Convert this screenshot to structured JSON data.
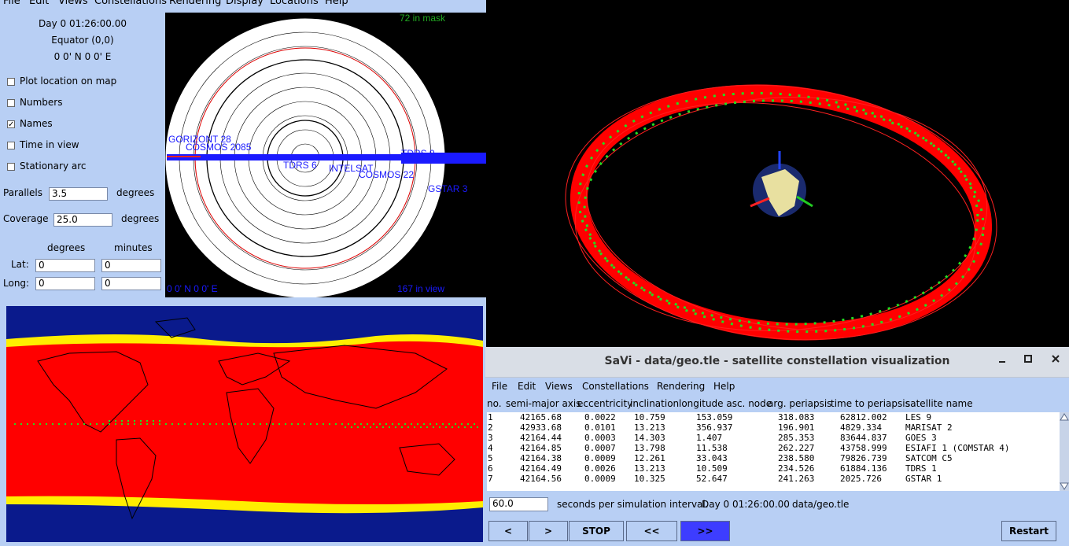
{
  "coverage_window": {
    "menu": [
      "File",
      "Edit",
      "Views",
      "Constellations",
      "Rendering",
      "Display",
      "Locations",
      "Help"
    ],
    "time_text": "Day 0  01:26:00.00",
    "location_name": "Equator (0,0)",
    "location_coords": "0  0' N 0  0' E",
    "checkboxes": [
      {
        "label": "Plot location on map",
        "checked": false,
        "mark": ""
      },
      {
        "label": "Numbers",
        "checked": false,
        "mark": ""
      },
      {
        "label": "Names",
        "checked": true,
        "mark": "✓"
      },
      {
        "label": "Time in view",
        "checked": false,
        "mark": ""
      },
      {
        "label": "Stationary arc",
        "checked": false,
        "mark": ""
      }
    ],
    "parallels": {
      "label": "Parallels",
      "value": "3.5",
      "unit": "degrees"
    },
    "coverage": {
      "label": "Coverage",
      "value": "25.0",
      "unit": "degrees"
    },
    "col_degrees": "degrees",
    "col_minutes": "minutes",
    "lat": {
      "label": "Lat:",
      "deg": "0",
      "min": "0"
    },
    "long": {
      "label": "Long:",
      "deg": "0",
      "min": "0"
    }
  },
  "polar_view": {
    "mask_count": "72 in mask",
    "view_count": "167 in view",
    "corner_coords": "0  0' N 0  0' E",
    "sat_labels": [
      {
        "text": "GORIZONT 28",
        "color": "#1a1aff"
      },
      {
        "text": "COSMOS 2085",
        "color": "#1a1aff"
      },
      {
        "text": "TDRS 9",
        "color": "#1a1aff"
      },
      {
        "text": "TDRS 6",
        "color": "#1a1aff"
      },
      {
        "text": "INTELSAT",
        "color": "#1a1aff"
      },
      {
        "text": "COSMOS 22",
        "color": "#1a1aff"
      },
      {
        "text": "GSTAR 3",
        "color": "#1a1aff"
      }
    ]
  },
  "savi_window": {
    "title": "SaVi - data/geo.tle - satellite constellation visualization",
    "controls": [
      "minimize-icon",
      "maximize-icon",
      "close-icon"
    ],
    "menu": [
      "File",
      "Edit",
      "Views",
      "Constellations",
      "Rendering",
      "Help"
    ],
    "columns": [
      "no.",
      "semi-major axis",
      "eccentricity",
      "inclination",
      "longitude asc. node",
      "arg. periapsis",
      "time to periapsis",
      "satellite name"
    ],
    "rows": [
      [
        "1",
        "42165.68",
        "0.0022",
        "10.759",
        "153.059",
        "318.083",
        "62812.002",
        "LES 9"
      ],
      [
        "2",
        "42933.68",
        "0.0101",
        "13.213",
        "356.937",
        "196.901",
        "4829.334",
        "MARISAT 2"
      ],
      [
        "3",
        "42164.44",
        "0.0003",
        "14.303",
        "1.407",
        "285.353",
        "83644.837",
        "GOES 3"
      ],
      [
        "4",
        "42164.85",
        "0.0007",
        "13.798",
        "11.538",
        "262.227",
        "43758.999",
        "ESIAFI 1 (COMSTAR 4)"
      ],
      [
        "5",
        "42164.38",
        "0.0009",
        "12.261",
        "33.043",
        "238.580",
        "79826.739",
        "SATCOM C5"
      ],
      [
        "6",
        "42164.49",
        "0.0026",
        "13.213",
        "10.509",
        "234.526",
        "61884.136",
        "TDRS 1"
      ],
      [
        "7",
        "42164.56",
        "0.0009",
        "10.325",
        "52.647",
        "241.263",
        "2025.726",
        "GSTAR 1"
      ]
    ],
    "interval_value": "60.0",
    "interval_label": "seconds per simulation interval.",
    "sim_time": "Day 0  01:26:00.00",
    "file": "data/geo.tle",
    "buttons": {
      "step_back": "<",
      "step_fwd": ">",
      "stop": "STOP",
      "rewind": "<<",
      "play": ">>",
      "restart": "Restart"
    }
  },
  "colors": {
    "panel": "#b8cff4",
    "coverage_red": "#ff0000",
    "coverage_yellow": "#ffee00",
    "ocean": "#0a1a8c",
    "sat_green": "#22dd22",
    "label_blue": "#1a1aff",
    "active_button": "#3d3dff"
  }
}
